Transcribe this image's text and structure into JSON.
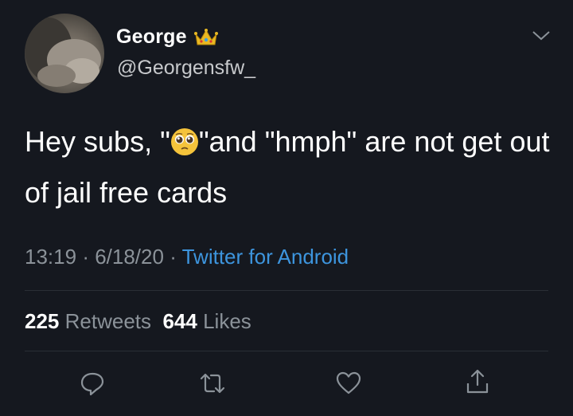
{
  "tweet": {
    "display_name": "George",
    "name_badge_icon": "crown-icon",
    "handle": "@Georgensfw_",
    "text_part1": "Hey subs, \"",
    "emoji_icon": "pleading-face-icon",
    "text_part2": "\"and \"hmph\" are not get out of jail free cards",
    "time": "13:19",
    "date": "6/18/20",
    "source": "Twitter for Android",
    "retweets_count": "225",
    "retweets_label": "Retweets",
    "likes_count": "644",
    "likes_label": "Likes"
  },
  "colors": {
    "background": "#15181f",
    "link": "#3d95de",
    "muted": "#8b9299"
  },
  "actions": [
    "reply-icon",
    "retweet-icon",
    "like-icon",
    "share-icon"
  ]
}
